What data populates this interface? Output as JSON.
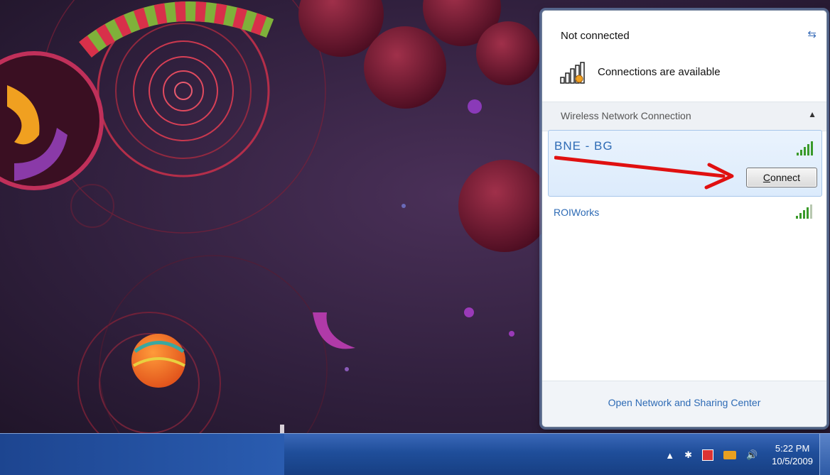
{
  "flyout": {
    "status_title": "Not connected",
    "status_subtitle": "Connections are available",
    "section_label": "Wireless Network Connection",
    "networks": [
      {
        "ssid": "BNE - BG",
        "signal_bars": 5,
        "selected": true,
        "action_label": "Connect",
        "action_mnemonic": "C"
      },
      {
        "ssid": "ROIWorks",
        "signal_bars": 4,
        "selected": false
      }
    ],
    "footer_link": "Open Network and Sharing Center"
  },
  "tray": {
    "time": "5:22 PM",
    "date": "10/5/2009",
    "icons": [
      "show-hidden-icon",
      "bluetooth-icon",
      "action-center-flag-icon",
      "network-warning-icon",
      "volume-icon"
    ]
  },
  "colors": {
    "link": "#2e6bb5",
    "taskbar": "#1f4e9a",
    "annotation_arrow": "#e01010"
  }
}
